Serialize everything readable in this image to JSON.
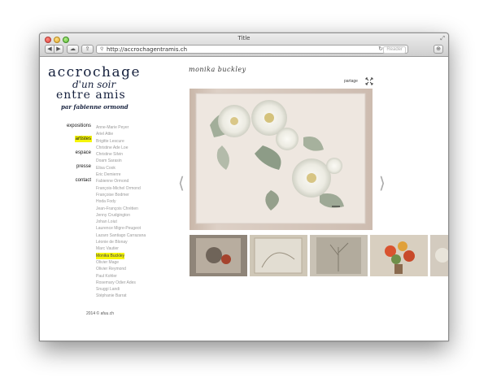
{
  "browser": {
    "window_title": "Title",
    "url": "http://accrochagentramis.ch",
    "reader_label": "Reader"
  },
  "logo": {
    "line1": "accrochage",
    "line2": "d'un soir",
    "line3": "entre amis",
    "line4": "par fabienne ormond"
  },
  "menu": {
    "items": [
      {
        "label": "expositions",
        "active": false
      },
      {
        "label": "artistes",
        "active": true
      },
      {
        "label": "espace",
        "active": false
      },
      {
        "label": "presse",
        "active": false
      },
      {
        "label": "contact",
        "active": false
      }
    ]
  },
  "artists": [
    "Anne-Marie Peyer",
    "Ariel Attie",
    "Brigitte Lescure",
    "Christine Ade Loe",
    "Christine Silvin",
    "Doam Sarasin",
    "Elisa Cook",
    "Eric Demierre",
    "Fabienne Ormond",
    "François-Michel Ormond",
    "Françoise Bodmer",
    "Hoda Fody",
    "Jean-François Chrétien",
    "Jenny Crudgington",
    "Johan Loiut",
    "Laurence Migre-Peugeot",
    "Lazaro Santiago Carrazana",
    "Léonie de Blonay",
    "Marc Vautier",
    "Monika Buckley",
    "Olivier Mage",
    "Olivier Reymond",
    "Paul Kohler",
    "Rosemary Odier Ades",
    "Snuggi Landi",
    "Stéphanie Barrat"
  ],
  "selected_artist_index": 19,
  "artist_title": "monika buckley",
  "share_label": "partage",
  "prev_arrow": "⟨",
  "next_arrow": "⟩",
  "footer": "2014 © afuu.ch",
  "colors": {
    "highlight": "#f5f50a",
    "logo": "#15203d",
    "artist_text": "#9a9a9a"
  }
}
